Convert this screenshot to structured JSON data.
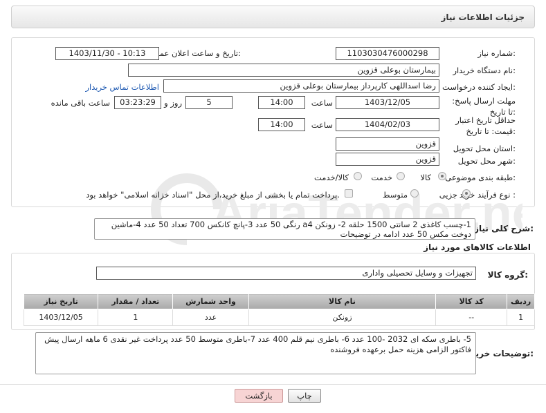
{
  "header": {
    "title": "جزئیات اطلاعات نیاز"
  },
  "fields": {
    "need_number_label": "شماره نیاز:",
    "need_number": "1103030476000298",
    "announce_label": "تاریخ و ساعت اعلان عمومی:",
    "announce_value": "1403/11/30 - 10:13",
    "buyer_org_label": "نام دستگاه خریدار:",
    "buyer_org": "بیمارستان بوعلی قزوین",
    "creator_label": "ایجاد کننده درخواست:",
    "creator": "رضا اسداللهی کارپرداز بیمارستان بوعلی قزوین",
    "contact_link": "اطلاعات تماس خریدار",
    "reply_deadline_label": "مهلت ارسال پاسخ: تا تاریخ:",
    "reply_date": "1403/12/05",
    "time_label": "ساعت",
    "reply_time": "14:00",
    "days_value": "5",
    "days_label": "روز و",
    "remaining_time": "03:23:29",
    "remaining_label": "ساعت باقی مانده",
    "price_validity_label": "حداقل تاریخ اعتبار قیمت: تا تاریخ:",
    "price_date": "1404/02/03",
    "price_time": "14:00",
    "province_label": "استان محل تحویل:",
    "province": "قزوین",
    "city_label": "شهر محل تحویل:",
    "city": "قزوین",
    "category_label": "طبقه بندی موضوعی:",
    "category_options": [
      "کالا",
      "خدمت",
      "کالا/خدمت"
    ],
    "process_label": "نوع فرآیند خرید :",
    "process_options": [
      "جزیی",
      "متوسط"
    ],
    "payment_note": "پرداخت تمام یا بخشی از مبلغ خرید،از محل \"اسناد خزانه اسلامی\" خواهد بود."
  },
  "description": {
    "label": "شرح کلی نیاز:",
    "text": "1-چسب کاغذی 2 سانتی 1500 حلقه 2- زونکن a4 رنگی 50 عدد  3-پانچ کانکس 700 تعداد 50 عدد 4-ماشین دوخت مکس 50 عدد  ادامه در توضیحات"
  },
  "goods": {
    "section_title": "اطلاعات کالاهای مورد نیاز",
    "group_label": "گروه کالا:",
    "group_value": "تجهیزات و وسایل تحصیلی واداری",
    "columns": [
      "ردیف",
      "کد کالا",
      "نام کالا",
      "واحد شمارش",
      "تعداد / مقدار",
      "تاریخ نیاز"
    ],
    "rows": [
      [
        "1",
        "--",
        "زونکن",
        "عدد",
        "1",
        "1403/12/05"
      ]
    ]
  },
  "buyer_notes": {
    "label": "توضیحات خریدار:",
    "text": "5- باطری سکه ای 2032 -100 عدد 6- باطری نیم قلم  400 عدد 7-باطری متوسط 50 عدد  پرداخت غیر نقدی 6 ماهه ارسال پیش فاکتور الزامی هزینه حمل برعهده فروشنده"
  },
  "buttons": {
    "print": "چاپ",
    "back": "بازگشت"
  },
  "watermark_text": "AriaTender.neT",
  "colors": {
    "link": "#1a56b0",
    "back_button_bg": "#f7d4d4",
    "watermark": "#e8e8e8"
  }
}
